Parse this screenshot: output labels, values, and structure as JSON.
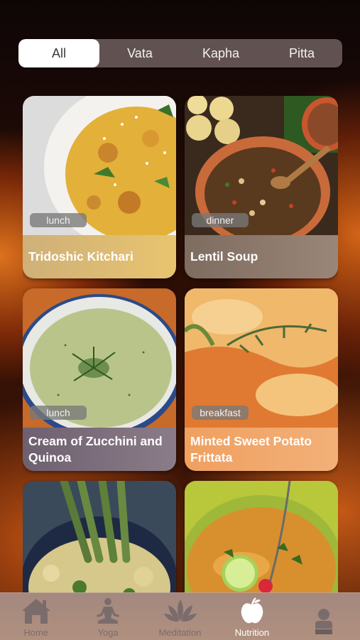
{
  "segments": [
    "All",
    "Vata",
    "Kapha",
    "Pitta"
  ],
  "recipes": [
    {
      "tag": "lunch",
      "title": "Tridoshic Kitchari",
      "caption_color": "#e3c06c"
    },
    {
      "tag": "dinner",
      "title": "Lentil Soup",
      "caption_color": "#8a786a"
    },
    {
      "tag": "lunch",
      "title": "Cream of Zucchini and Quinoa",
      "caption_color": "#7a6e78"
    },
    {
      "tag": "breakfast",
      "title": "Minted Sweet Potato Frittata",
      "caption_color": "#f0a064"
    },
    {
      "tag": "",
      "title": "",
      "caption_color": "#6e7a78"
    },
    {
      "tag": "",
      "title": "",
      "caption_color": "#b89a40"
    }
  ],
  "tabbar": {
    "home": "Home",
    "yoga": "Yoga",
    "meditation": "Meditation",
    "nutrition": "Nutrition",
    "profile": ""
  },
  "colors": {
    "active_tab": "#ffffff",
    "inactive_tab": "#7b6c6c",
    "segment_bg": "#6e5f5f"
  }
}
